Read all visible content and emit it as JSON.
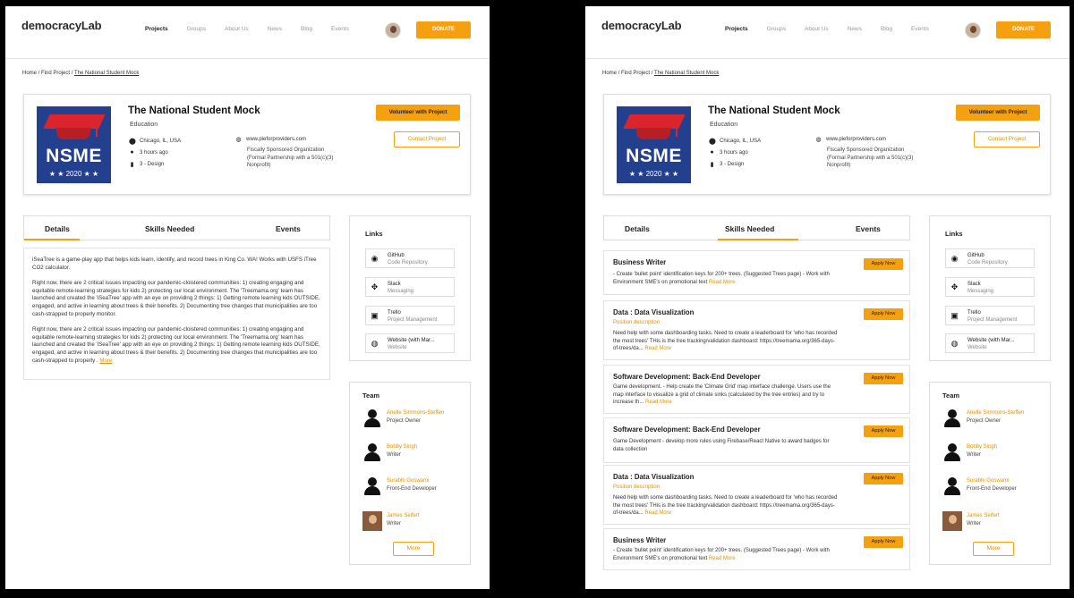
{
  "nav": {
    "logo": "democracyLab",
    "links": [
      "Projects",
      "Groups",
      "About Us",
      "News",
      "Blog",
      "Events"
    ],
    "donate": "DONATE"
  },
  "breadcrumb": {
    "home": "Home",
    "sep": "/",
    "find": "Find Project",
    "current": "The National Student Mock"
  },
  "project": {
    "image_text": "NSME",
    "image_stars": "★ ★ 2020 ★ ★",
    "title": "The National Student Mock",
    "category": "Education",
    "location": "Chicago, IL, USA",
    "updated": "3 hours ago",
    "stage": "3 - Design",
    "website": "www.pieforproviders.com",
    "org": "Fiscally Sponsored Organization (Formal Partnership with a 501(c)(3) Nonprofit)",
    "volunteer": "Volunteer with Project",
    "contact": "Contact Project"
  },
  "tabs": {
    "details": "Details",
    "skills": "Skills Needed",
    "events": "Events"
  },
  "details": {
    "p1": "iSeaTree is a game-play app that helps kids learn, identify, and record trees in King Co. WA! Works with USFS iTree CO2 calculator.",
    "p2": "Right now, there are 2 critical issues impacting our pandemic-cloistered communities: 1) creating engaging and equitable remote-learning strategies for kids 2) protecting our local environment. The 'Treemama.org' team has launched and created the 'iSeaTree' app with an eye on providing 2 things: 1) Getting remote learning kids OUTSIDE, engaged, and active in learning about trees & their benefits. 2) Documenting tree changes that municipalities are too cash-strapped to properly monitor.",
    "p3": "Right now, there are 2 critical issues impacting our pandemic-cloistered communities: 1) creating engaging and equitable remote-learning strategies for kids 2) protecting our local environment. The 'Treemama.org' team has launched and created the 'iSeaTree' app with an eye on providing 2 things: 1) Getting remote learning kids OUTSIDE, engaged, and active in learning about trees & their benefits. 2) Documenting tree changes that municipalities are too cash-strapped to properly .",
    "more": "More"
  },
  "links": {
    "title": "Links",
    "items": [
      {
        "name": "GitHub",
        "sub": "Code Repository",
        "icon": "github-icon"
      },
      {
        "name": "Slack",
        "sub": "Messaging",
        "icon": "slack-icon"
      },
      {
        "name": "Trello",
        "sub": "Project Management",
        "icon": "trello-icon"
      },
      {
        "name": "Website (with Mar...",
        "sub": "Website",
        "icon": "globe-icon"
      }
    ]
  },
  "team": {
    "title": "Team",
    "members": [
      {
        "name": "Arielle Simmons-Steffen",
        "role": "Project Owner"
      },
      {
        "name": "Bobby Singh",
        "role": "Writer"
      },
      {
        "name": "Surabhi Goswami",
        "role": "Front-End Developer"
      },
      {
        "name": "James Seifert",
        "role": "Writer"
      }
    ],
    "more": "More"
  },
  "skills": [
    {
      "title": "Business Writer",
      "sub": "",
      "desc": "- Create 'bullet point' identification keys for 200+ trees. (Suggested Trees page) - Work with Environment SME's on promotional text",
      "read": "Read More",
      "apply": "Apply Now"
    },
    {
      "title": "Data : Data Visualization",
      "sub": "Position description",
      "desc": "Need help with some dashboarding tasks. Need to create a leaderboard for 'who has recorded the most trees' THis is the tree tracking/validation dashboard: https://treemama.org/365-days-of-trees/da...",
      "read": "Read More",
      "apply": "Apply Now"
    },
    {
      "title": "Software Development: Back-End Developer",
      "sub": "",
      "desc": "Game development. - Help create the 'Climate Grid' map interface challenge. Users use the map interface to visualize a grid of climate sinks (calculated by the tree entries) and try to increase th...",
      "read": "Read More",
      "apply": "Apply Now"
    },
    {
      "title": "Software Development: Back-End Developer",
      "sub": "",
      "desc": "Game Development - develop more rules using Firebase/React Native to award badges for data collection",
      "read": "",
      "apply": "Apply Now"
    },
    {
      "title": "Data : Data Visualization",
      "sub": "Position description",
      "desc": "Need help with some dashboarding tasks. Need to create a leaderboard for 'who has recorded the most trees' THis is the tree tracking/validation dashboard: https://treemama.org/365-days-of-trees/da...",
      "read": "Read More",
      "apply": "Apply Now"
    },
    {
      "title": "Business Writer",
      "sub": "",
      "desc": "- Create 'bullet point' identification keys for 200+ trees. (Suggested Trees page) - Work with Environment SME's on promotional text",
      "read": "Read More",
      "apply": "Apply Now"
    }
  ]
}
